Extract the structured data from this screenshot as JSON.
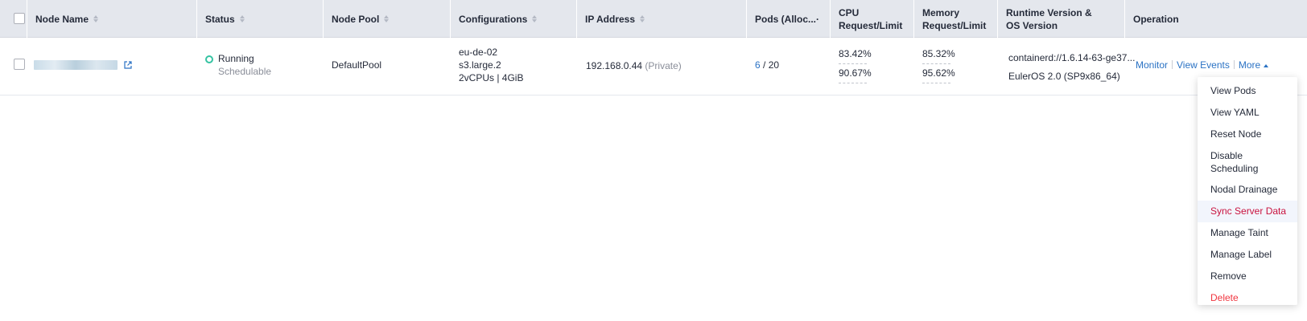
{
  "headers": {
    "node_name": "Node Name",
    "status": "Status",
    "node_pool": "Node Pool",
    "configurations": "Configurations",
    "ip_address": "IP Address",
    "pods": "Pods (Alloc...·",
    "cpu_line1": "CPU",
    "cpu_line2": "Request/Limit",
    "mem_line1": "Memory",
    "mem_line2": "Request/Limit",
    "runtime_line1": "Runtime Version &",
    "runtime_line2": "OS Version",
    "operation": "Operation"
  },
  "row": {
    "status": "Running",
    "schedulable": "Schedulable",
    "node_pool": "DefaultPool",
    "config_az": "eu-de-02",
    "config_flavor": "s3.large.2",
    "config_specs": "2vCPUs | 4GiB",
    "ip": "192.168.0.44",
    "ip_type": "(Private)",
    "pods_used": "6",
    "pods_sep": " / ",
    "pods_total": "20",
    "cpu_request": "83.42%",
    "cpu_limit": "90.67%",
    "mem_request": "85.32%",
    "mem_limit": "95.62%",
    "runtime": "containerd://1.6.14-63-ge37...",
    "os": "EulerOS 2.0 (SP9x86_64)"
  },
  "operations": {
    "monitor": "Monitor",
    "view_events": "View Events",
    "more": "More"
  },
  "menu": {
    "items": [
      "View Pods",
      "View YAML",
      "Reset Node",
      "Disable Scheduling",
      "Nodal Drainage",
      "Sync Server Data",
      "Manage Taint",
      "Manage Label",
      "Remove",
      "Delete"
    ],
    "hovered_index": 5
  },
  "colors": {
    "header_bg": "#e4e7ed",
    "link": "#2a72c4",
    "running": "#35c3a2",
    "danger": "#f0353f",
    "hover_text": "#c9133f"
  }
}
